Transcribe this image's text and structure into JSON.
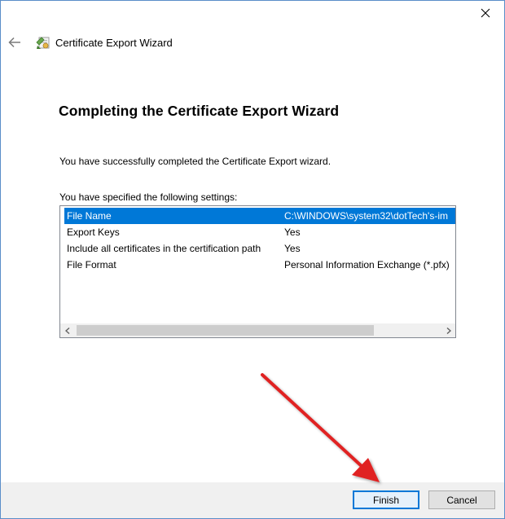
{
  "wizard": {
    "title": "Certificate Export Wizard",
    "heading": "Completing the Certificate Export Wizard",
    "success_message": "You have successfully completed the Certificate Export wizard.",
    "settings_label": "You have specified the following settings:"
  },
  "settings": [
    {
      "name": "File Name",
      "value": "C:\\WINDOWS\\system32\\dotTech's-im",
      "selected": true
    },
    {
      "name": "Export Keys",
      "value": "Yes",
      "selected": false
    },
    {
      "name": "Include all certificates in the certification path",
      "value": "Yes",
      "selected": false
    },
    {
      "name": "File Format",
      "value": "Personal Information Exchange (*.pfx)",
      "selected": false
    }
  ],
  "buttons": {
    "finish": "Finish",
    "cancel": "Cancel"
  },
  "icons": {
    "close": "close-icon",
    "back": "back-arrow-icon",
    "wizard": "certificate-wizard-icon",
    "scroll_left": "scroll-left-icon",
    "scroll_right": "scroll-right-icon"
  },
  "colors": {
    "selection": "#0078d7",
    "window_border": "#5a8ec9",
    "annotation_arrow": "#e02020"
  }
}
